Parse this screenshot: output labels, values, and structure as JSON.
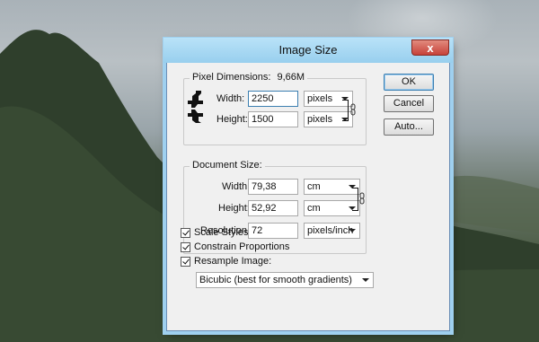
{
  "dialog": {
    "title": "Image Size",
    "close_glyph": "x"
  },
  "pixel_dimensions": {
    "title": "Pixel Dimensions:",
    "size": "9,66M",
    "width_label": "Width:",
    "width_value": "2250",
    "width_unit": "pixels",
    "height_label": "Height:",
    "height_value": "1500",
    "height_unit": "pixels"
  },
  "document_size": {
    "title": "Document Size:",
    "width_label": "Width:",
    "width_value": "79,38",
    "width_unit": "cm",
    "height_label": "Height:",
    "height_value": "52,92",
    "height_unit": "cm",
    "resolution_label": "Resolution:",
    "resolution_value": "72",
    "resolution_unit": "pixels/inch"
  },
  "buttons": {
    "ok": "OK",
    "cancel": "Cancel",
    "auto": "Auto..."
  },
  "options": {
    "scale_styles": "Scale Styles",
    "constrain_proportions": "Constrain Proportions",
    "resample_image": "Resample Image:",
    "resample_method": "Bicubic (best for smooth gradients)"
  },
  "icons": {
    "link": "chain-link-icon",
    "cursor": "move-cursor-icon"
  }
}
